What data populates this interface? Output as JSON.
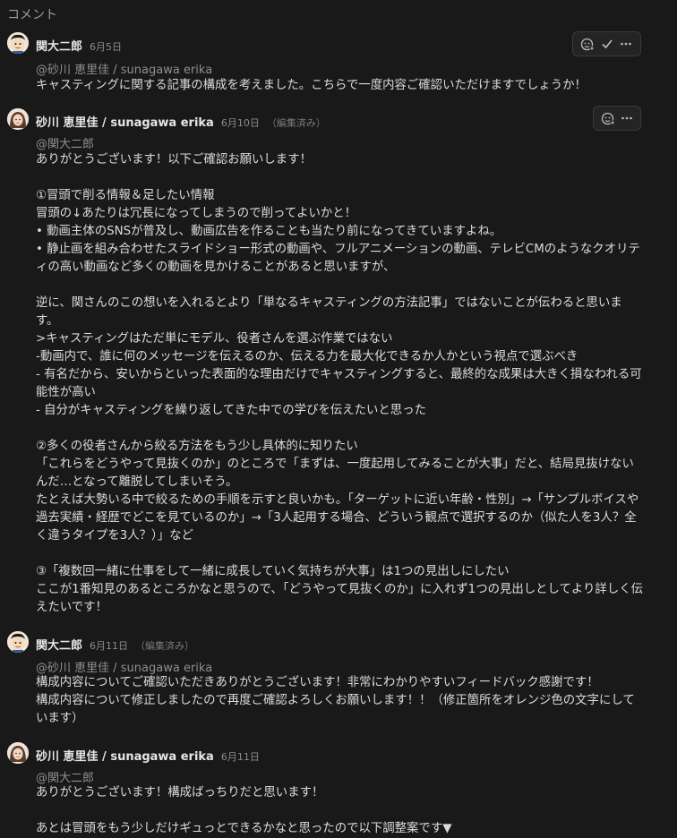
{
  "section": {
    "title": "コメント"
  },
  "comments": [
    {
      "author": "関大二郎",
      "date": "6月5日",
      "edited": "",
      "mention": "@砂川 恵里佳 / sunagawa erika",
      "body": "キャスティングに関する記事の構成を考えました。こちらで一度内容ご確認いただけますでしょうか！"
    },
    {
      "author": "砂川 恵里佳 / sunagawa erika",
      "date": "6月10日",
      "edited": "（編集済み）",
      "mention": "@関大二郎",
      "body": "ありがとうございます！以下ご確認お願いします！\n\n①冒頭で削る情報＆足したい情報\n冒頭の↓あたりは冗長になってしまうので削ってよいかと！\n• 動画主体のSNSが普及し、動画広告を作ることも当たり前になってきていますよね。\n• 静止画を組み合わせたスライドショー形式の動画や、フルアニメーションの動画、テレビCMのようなクオリティの高い動画など多くの動画を見かけることがあると思いますが、\n\n逆に、関さんのこの想いを入れるとより「単なるキャスティングの方法記事」ではないことが伝わると思います。\n>キャスティングはただ単にモデル、役者さんを選ぶ作業ではない\n-動画内で、誰に何のメッセージを伝えるのか、伝える力を最大化できるか人かという視点で選ぶべき\n- 有名だから、安いからといった表面的な理由だけでキャスティングすると、最終的な成果は大きく損なわれる可能性が高い\n- 自分がキャスティングを繰り返してきた中での学びを伝えたいと思った\n\n②多くの役者さんから絞る方法をもう少し具体的に知りたい\n「これらをどうやって見抜くのか」のところで「まずは、一度起用してみることが大事」だと、結局見抜けないんだ…となって離脱してしまいそう。\nたとえば大勢いる中で絞るための手順を示すと良いかも。「ターゲットに近い年齢・性別」→「サンプルボイスや過去実績・経歴でどこを見ているのか」→「3人起用する場合、どういう観点で選択するのか（似た人を3人？全く違うタイプを3人？）」など\n\n③「複数回一緒に仕事をして一緒に成長していく気持ちが大事」は1つの見出しにしたい\nここが1番知見のあるところかなと思うので、「どうやって見抜くのか」に入れず1つの見出しとしてより詳しく伝えたいです！"
    },
    {
      "author": "関大二郎",
      "date": "6月11日",
      "edited": "（編集済み）",
      "mention": "@砂川 恵里佳 / sunagawa erika",
      "body": "構成内容についてご確認いただきありがとうございます！非常にわかりやすいフィードバック感謝です！\n構成内容について修正しましたので再度ご確認よろしくお願いします！！（修正箇所をオレンジ色の文字にしています）"
    },
    {
      "author": "砂川 恵里佳 / sunagawa erika",
      "date": "6月11日",
      "edited": "",
      "mention": "@関大二郎",
      "body": "ありがとうございます！構成ばっちりだと思います！\n\nあとは冒頭をもう少しだけギュっとできるかなと思ったので以下調整案です▼"
    }
  ],
  "actions": {
    "emoji_icon": "add-reaction-icon",
    "resolve_icon": "checkmark-icon",
    "more_icon": "more-horizontal-icon"
  }
}
